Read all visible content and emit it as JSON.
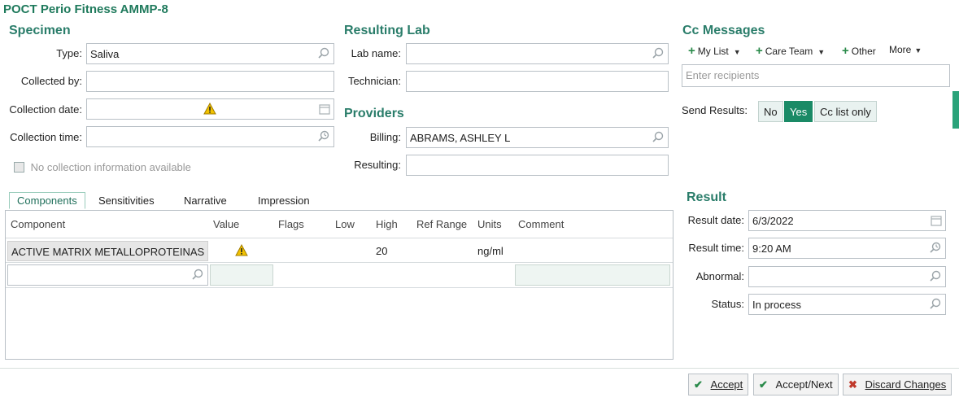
{
  "title": "POCT Perio Fitness AMMP-8",
  "specimen": {
    "heading": "Specimen",
    "type_label": "Type:",
    "type_value": "Saliva",
    "collected_by_label": "Collected by:",
    "collection_date_label": "Collection date:",
    "collection_time_label": "Collection time:",
    "no_collection_label": "No collection information available"
  },
  "resulting_lab": {
    "heading": "Resulting Lab",
    "lab_name_label": "Lab name:",
    "technician_label": "Technician:"
  },
  "providers": {
    "heading": "Providers",
    "billing_label": "Billing:",
    "billing_value": "ABRAMS, ASHLEY L",
    "resulting_label": "Resulting:"
  },
  "cc_messages": {
    "heading": "Cc Messages",
    "my_list": "My List",
    "care_team": "Care Team",
    "other": "Other",
    "more": "More",
    "recipients_placeholder": "Enter recipients",
    "send_results_label": "Send Results:",
    "send_no": "No",
    "send_yes": "Yes",
    "send_cc_only": "Cc list only"
  },
  "tabs": [
    "Components",
    "Sensitivities",
    "Narrative",
    "Impression"
  ],
  "grid": {
    "headers": [
      "Component",
      "Value",
      "Flags",
      "Low",
      "High",
      "Ref Range",
      "Units",
      "Comment"
    ],
    "rows": [
      {
        "component": "ACTIVE MATRIX METALLOPROTEINAS",
        "high": "20",
        "units": "ng/ml"
      }
    ]
  },
  "result": {
    "heading": "Result",
    "date_label": "Result date:",
    "date_value": "6/3/2022",
    "time_label": "Result time:",
    "time_value": "9:20 AM",
    "abnormal_label": "Abnormal:",
    "status_label": "Status:",
    "status_value": "In process"
  },
  "footer": {
    "accept": "Accept",
    "accept_next": "Accept/Next",
    "discard": "Discard Changes"
  },
  "colors": {
    "accent": "#1a8a66",
    "heading": "#2a7d6a",
    "warning": "#f2c200"
  }
}
